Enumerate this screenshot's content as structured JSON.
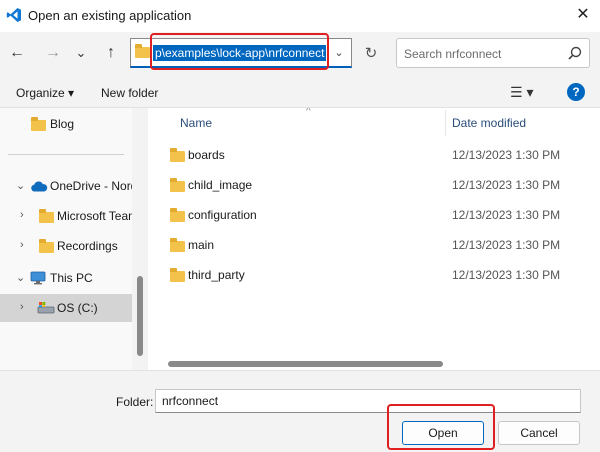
{
  "window": {
    "title": "Open an existing application",
    "close_glyph": "✕"
  },
  "nav": {
    "back": "←",
    "forward": "→",
    "recent": "⌄",
    "up": "↑",
    "refresh": "↻",
    "addr_dropdown": "⌄"
  },
  "address": {
    "path": "p\\examples\\lock-app\\nrfconnect"
  },
  "search": {
    "placeholder": "Search nrfconnect"
  },
  "toolbar": {
    "organize": "Organize ▾",
    "new_folder": "New folder",
    "view": "☰ ▾",
    "help": "?"
  },
  "sidebar": {
    "items": [
      {
        "label": "Blog"
      },
      {
        "label": "OneDrive - Nord"
      },
      {
        "label": "Microsoft Team"
      },
      {
        "label": "Recordings"
      },
      {
        "label": "This PC"
      },
      {
        "label": "OS (C:)"
      }
    ]
  },
  "columns": {
    "name": "Name",
    "date": "Date modified"
  },
  "files": [
    {
      "name": "boards",
      "date": "12/13/2023 1:30 PM"
    },
    {
      "name": "child_image",
      "date": "12/13/2023 1:30 PM"
    },
    {
      "name": "configuration",
      "date": "12/13/2023 1:30 PM"
    },
    {
      "name": "main",
      "date": "12/13/2023 1:30 PM"
    },
    {
      "name": "third_party",
      "date": "12/13/2023 1:30 PM"
    }
  ],
  "footer": {
    "folder_label": "Folder:",
    "folder_value": "nrfconnect",
    "open": "Open",
    "cancel": "Cancel"
  },
  "colors": {
    "accent": "#0067c0",
    "highlight": "#e02020",
    "folder": "#f3c24b"
  }
}
